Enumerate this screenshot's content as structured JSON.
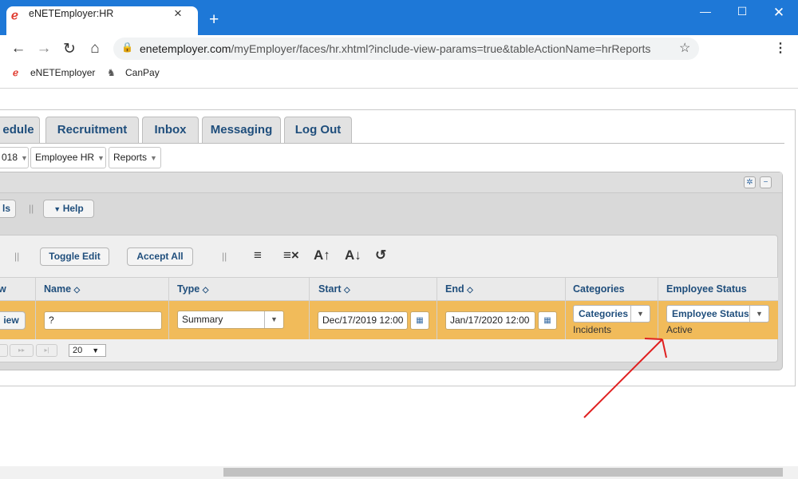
{
  "browser": {
    "tab_title": "eNETEmployer:HR",
    "url_domain": "enetemployer.com",
    "url_path": "/myEmployer/faces/hr.xhtml?include-view-params=true&tableActionName=hrReports",
    "bookmarks": [
      {
        "label": "eNETEmployer"
      },
      {
        "label": "CanPay"
      }
    ]
  },
  "app_tabs": [
    {
      "label": "edule"
    },
    {
      "label": "Recruitment"
    },
    {
      "label": "Inbox"
    },
    {
      "label": "Messaging"
    },
    {
      "label": "Log Out"
    }
  ],
  "breadcrumbs": [
    {
      "label": "018"
    },
    {
      "label": "Employee HR"
    },
    {
      "label": "Reports"
    }
  ],
  "panel": {
    "left_button_label": "ls",
    "help_label": "Help"
  },
  "toolbar": {
    "toggle_edit": "Toggle Edit",
    "accept_all": "Accept All"
  },
  "table": {
    "columns": [
      {
        "label": "w"
      },
      {
        "label": "Name"
      },
      {
        "label": "Type"
      },
      {
        "label": "Start"
      },
      {
        "label": "End"
      },
      {
        "label": "Categories"
      },
      {
        "label": "Employee Status"
      }
    ],
    "row": {
      "view_label": "iew",
      "name_value": "?",
      "type_value": "Summary",
      "start_value": "Dec/17/2019 12:00",
      "end_value": "Jan/17/2020 12:00",
      "categories_button": "Categories",
      "categories_value": "Incidents",
      "status_button": "Employee Status",
      "status_value": "Active"
    }
  },
  "pager": {
    "rows_per_page": "20"
  },
  "colors": {
    "browser_blue": "#1e78d7",
    "row_highlight": "#f1bb5a",
    "tab_text": "#1f4e7c",
    "annotation_arrow": "#e02020"
  },
  "icons": [
    "ie-logo-icon",
    "close-icon",
    "plus-icon",
    "minimize-icon",
    "maximize-icon",
    "back-icon",
    "forward-icon",
    "reload-icon",
    "home-icon",
    "lock-icon",
    "star-icon",
    "kebab-menu-icon",
    "gear-icon",
    "collapse-icon",
    "wrap-icon",
    "clear-icon",
    "font-increase-icon",
    "font-decrease-icon",
    "reset-icon",
    "calendar-icon",
    "sort-icon"
  ]
}
